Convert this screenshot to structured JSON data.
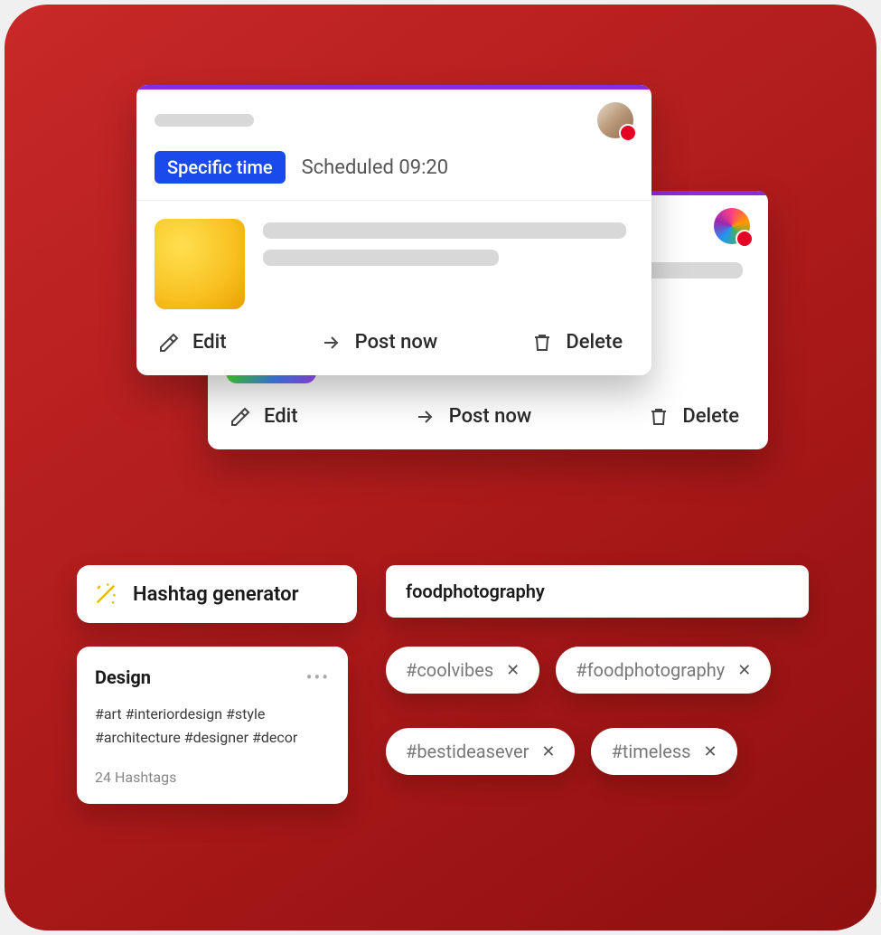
{
  "card1": {
    "badge": "Specific time",
    "schedule": "Scheduled 09:20",
    "actions": {
      "edit": "Edit",
      "post": "Post now",
      "delete": "Delete"
    }
  },
  "card2": {
    "actions": {
      "edit": "Edit",
      "post": "Post now",
      "delete": "Delete"
    }
  },
  "hashgen": {
    "label": "Hashtag generator"
  },
  "design": {
    "title": "Design",
    "tags": "#art  #interiordesign  #style #architecture #designer #decor",
    "count": "24 Hashtags"
  },
  "search": {
    "value": "foodphotography"
  },
  "chips": {
    "row1": [
      "#coolvibes",
      "#foodphotography"
    ],
    "row2": [
      "#bestideasever",
      "#timeless"
    ]
  }
}
